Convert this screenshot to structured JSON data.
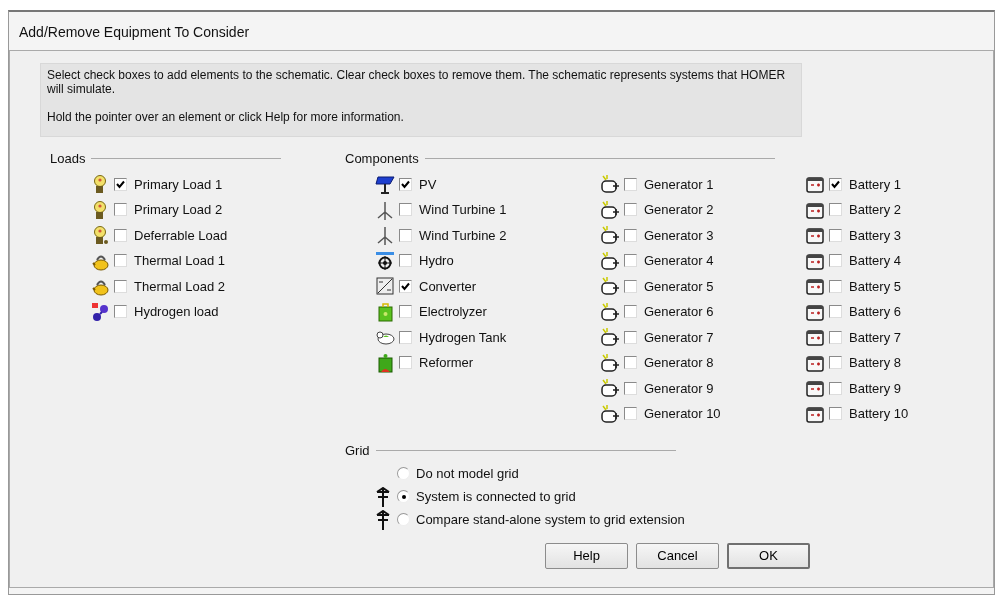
{
  "window": {
    "title": "Add/Remove Equipment To Consider"
  },
  "info": {
    "lines": [
      "Select check boxes to add elements to the schematic. Clear check boxes to remove them. The schematic represents systems that HOMER will simulate.",
      "Hold the pointer over an element or click Help for more information."
    ]
  },
  "loads": {
    "title": "Loads",
    "items": [
      {
        "label": "Primary Load 1",
        "kind": "primary",
        "checked": true
      },
      {
        "label": "Primary Load 2",
        "kind": "primary",
        "checked": false
      },
      {
        "label": "Deferrable Load",
        "kind": "deferrable",
        "checked": false
      },
      {
        "label": "Thermal Load 1",
        "kind": "thermal",
        "checked": false
      },
      {
        "label": "Thermal Load 2",
        "kind": "thermal",
        "checked": false
      },
      {
        "label": "Hydrogen load",
        "kind": "hydrogen",
        "checked": false
      }
    ]
  },
  "components": {
    "title": "Components",
    "columns": [
      [
        {
          "label": "PV",
          "kind": "pv",
          "checked": true
        },
        {
          "label": "Wind Turbine 1",
          "kind": "wind",
          "checked": false
        },
        {
          "label": "Wind Turbine 2",
          "kind": "wind",
          "checked": false
        },
        {
          "label": "Hydro",
          "kind": "hydro",
          "checked": false
        },
        {
          "label": "Converter",
          "kind": "converter",
          "checked": true
        },
        {
          "label": "Electrolyzer",
          "kind": "electrolyzer",
          "checked": false
        },
        {
          "label": "Hydrogen Tank",
          "kind": "tank",
          "checked": false
        },
        {
          "label": "Reformer",
          "kind": "reformer",
          "checked": false
        }
      ],
      [
        {
          "label": "Generator 1",
          "kind": "generator",
          "checked": false
        },
        {
          "label": "Generator 2",
          "kind": "generator",
          "checked": false
        },
        {
          "label": "Generator 3",
          "kind": "generator",
          "checked": false
        },
        {
          "label": "Generator 4",
          "kind": "generator",
          "checked": false
        },
        {
          "label": "Generator 5",
          "kind": "generator",
          "checked": false
        },
        {
          "label": "Generator 6",
          "kind": "generator",
          "checked": false
        },
        {
          "label": "Generator 7",
          "kind": "generator",
          "checked": false
        },
        {
          "label": "Generator 8",
          "kind": "generator",
          "checked": false
        },
        {
          "label": "Generator 9",
          "kind": "generator",
          "checked": false
        },
        {
          "label": "Generator 10",
          "kind": "generator",
          "checked": false
        }
      ],
      [
        {
          "label": "Battery 1",
          "kind": "battery",
          "checked": true
        },
        {
          "label": "Battery 2",
          "kind": "battery",
          "checked": false
        },
        {
          "label": "Battery 3",
          "kind": "battery",
          "checked": false
        },
        {
          "label": "Battery 4",
          "kind": "battery",
          "checked": false
        },
        {
          "label": "Battery 5",
          "kind": "battery",
          "checked": false
        },
        {
          "label": "Battery 6",
          "kind": "battery",
          "checked": false
        },
        {
          "label": "Battery 7",
          "kind": "battery",
          "checked": false
        },
        {
          "label": "Battery 8",
          "kind": "battery",
          "checked": false
        },
        {
          "label": "Battery 9",
          "kind": "battery",
          "checked": false
        },
        {
          "label": "Battery 10",
          "kind": "battery",
          "checked": false
        }
      ]
    ]
  },
  "grid": {
    "title": "Grid",
    "options": [
      {
        "label": "Do not model grid",
        "kind": "none",
        "selected": false
      },
      {
        "label": "System is connected to grid",
        "kind": "tower",
        "selected": true
      },
      {
        "label": "Compare stand-alone system to grid extension",
        "kind": "tower",
        "selected": false
      }
    ]
  },
  "buttons": [
    {
      "label": "Help"
    },
    {
      "label": "Cancel"
    },
    {
      "label": "OK"
    }
  ]
}
